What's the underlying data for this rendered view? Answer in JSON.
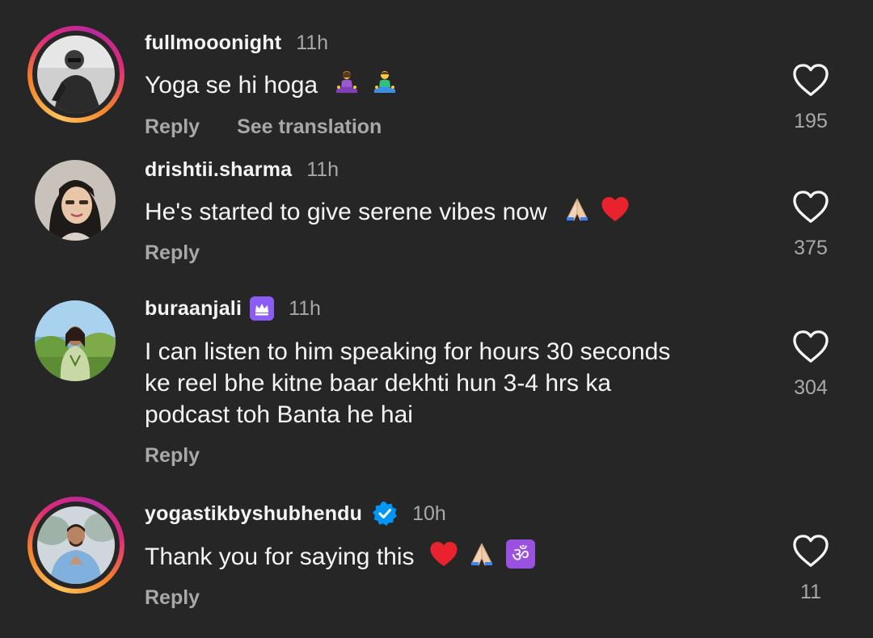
{
  "comments": [
    {
      "username": "fullmooonight",
      "time": "11h",
      "text": "Yoga se hi hoga",
      "actions": {
        "reply": "Reply",
        "translate": "See translation"
      },
      "likes": "195"
    },
    {
      "username": "drishtii.sharma",
      "time": "11h",
      "text": "He's started to give serene vibes now",
      "actions": {
        "reply": "Reply"
      },
      "likes": "375"
    },
    {
      "username": "buraanjali",
      "time": "11h",
      "text_lines": [
        "I can listen to him speaking for hours 30 seconds",
        "ke reel bhe kitne baar dekhti hun 3-4 hrs ka",
        "podcast toh Banta he hai"
      ],
      "actions": {
        "reply": "Reply"
      },
      "likes": "304"
    },
    {
      "username": "yogastikbyshubhendu",
      "time": "10h",
      "text": "Thank you for saying this",
      "actions": {
        "reply": "Reply"
      },
      "likes": "11"
    }
  ],
  "colors": {
    "background": "#262626",
    "primary_text": "#f5f5f5",
    "secondary_text": "#a8a8a8",
    "verified": "#0095f6",
    "subscriber_badge": "#8b5cf6"
  }
}
